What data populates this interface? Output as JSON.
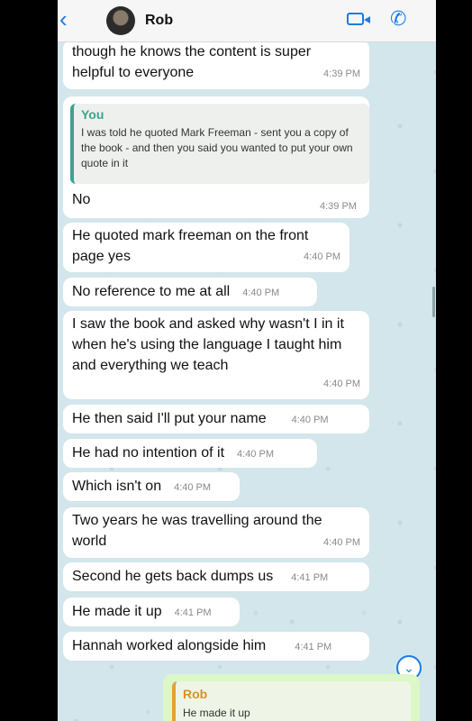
{
  "header": {
    "back": "‹",
    "contact": "Rob"
  },
  "messages": [
    {
      "text": "though he knows the content is super helpful to everyone",
      "time": "4:39 PM"
    },
    {
      "reply_author": "You",
      "reply_text": "I was told he quoted Mark Freeman - sent you a copy of the book - and then you said you wanted to put your own quote in it",
      "text": "No",
      "time": "4:39 PM"
    },
    {
      "text": "He quoted mark freeman on the front page yes",
      "time": "4:40 PM"
    },
    {
      "text": "No reference to me at all",
      "time": "4:40 PM"
    },
    {
      "text": "I saw the book and asked why wasn't I in it when he's using the language I taught him and everything we teach",
      "time": "4:40 PM"
    },
    {
      "text": "He then said I'll put your name",
      "time": "4:40 PM"
    },
    {
      "text": "He had no intention of it",
      "time": "4:40 PM"
    },
    {
      "text": "Which isn't on",
      "time": "4:40 PM"
    },
    {
      "text": "Two years he was travelling around the world",
      "time": "4:40 PM"
    },
    {
      "text": "Second he gets back dumps us",
      "time": "4:41 PM"
    },
    {
      "text": "He made it up",
      "time": "4:41 PM"
    },
    {
      "text": "Hannah worked alongside him",
      "time": "4:41 PM"
    }
  ],
  "outgoing": {
    "reply_author": "Rob",
    "reply_text": "He made it up"
  },
  "icons": {
    "video": "video-call-icon",
    "call": "phone-icon",
    "scroll": "scroll-down-icon"
  }
}
